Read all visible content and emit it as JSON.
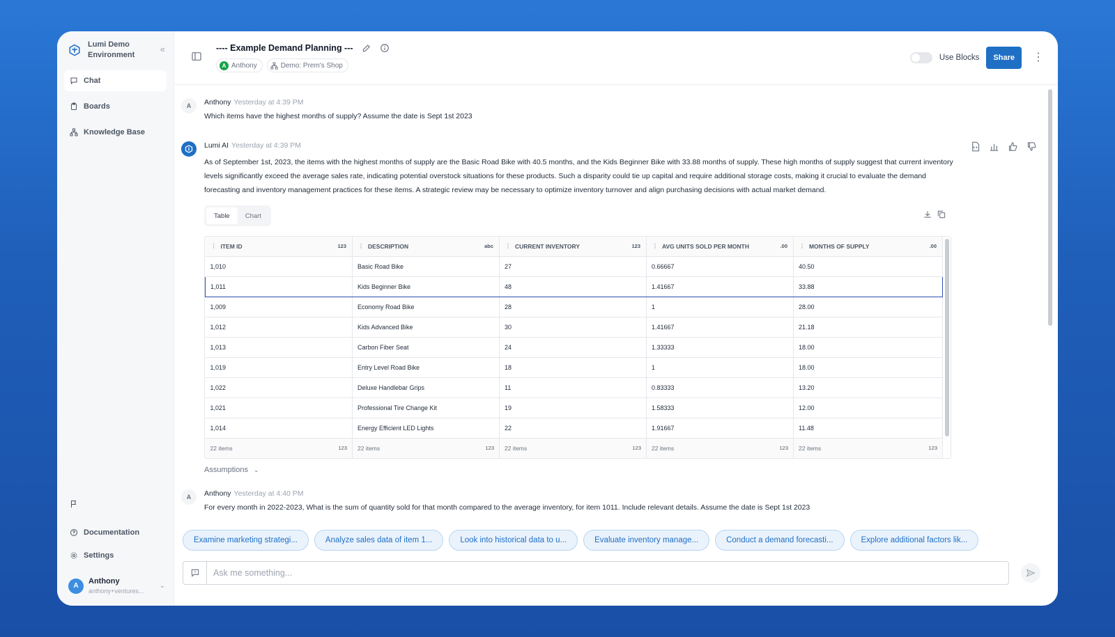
{
  "sidebar": {
    "brand": "Lumi Demo Environment",
    "nav": [
      {
        "label": "Chat",
        "icon": "chat-bubble-icon",
        "active": true
      },
      {
        "label": "Boards",
        "icon": "clipboard-icon",
        "active": false
      },
      {
        "label": "Knowledge Base",
        "icon": "hierarchy-icon",
        "active": false
      }
    ],
    "documentation": "Documentation",
    "settings": "Settings",
    "user": {
      "initial": "A",
      "name": "Anthony",
      "email": "anthony+ventures..."
    }
  },
  "header": {
    "title": "---- Example Demand Planning ---",
    "owner_initial": "A",
    "owner": "Anthony",
    "workspace": "Demo: Prem's Shop",
    "use_blocks_label": "Use Blocks",
    "share_label": "Share"
  },
  "messages": [
    {
      "author": "Anthony",
      "initial": "A",
      "time": "Yesterday at 4:39 PM",
      "text": "Which items have the highest months of supply? Assume the date is Sept 1st 2023"
    },
    {
      "author": "Lumi AI",
      "time": "Yesterday at 4:39 PM",
      "text": "As of September 1st, 2023, the items with the highest months of supply are the Basic Road Bike with 40.5 months, and the Kids Beginner Bike with 33.88 months of supply. These high months of supply suggest that current inventory levels significantly exceed the average sales rate, indicating potential overstock situations for these products. Such a disparity could tie up capital and require additional storage costs, making it crucial to evaluate the demand forecasting and inventory management practices for these items. A strategic review may be necessary to optimize inventory turnover and align purchasing decisions with actual market demand."
    },
    {
      "author": "Anthony",
      "initial": "A",
      "time": "Yesterday at 4:40 PM",
      "text": "For every month in 2022-2023, What is the sum of quantity sold for that month compared to the average inventory, for item 1011. Include relevant details. Assume the date is Sept 1st 2023"
    }
  ],
  "result": {
    "tabs": [
      "Table",
      "Chart"
    ],
    "active_tab": "Table",
    "columns": [
      {
        "label": "ITEM ID",
        "type": "123"
      },
      {
        "label": "DESCRIPTION",
        "type": "abc"
      },
      {
        "label": "CURRENT INVENTORY",
        "type": "123"
      },
      {
        "label": "AVG UNITS SOLD PER MONTH",
        "type": ".00"
      },
      {
        "label": "MONTHS OF SUPPLY",
        "type": ".00"
      }
    ],
    "rows": [
      [
        "1,010",
        "Basic Road Bike",
        "27",
        "0.66667",
        "40.50"
      ],
      [
        "1,011",
        "Kids Beginner Bike",
        "48",
        "1.41667",
        "33.88"
      ],
      [
        "1,009",
        "Economy Road Bike",
        "28",
        "1",
        "28.00"
      ],
      [
        "1,012",
        "Kids Advanced Bike",
        "30",
        "1.41667",
        "21.18"
      ],
      [
        "1,013",
        "Carbon Fiber Seat",
        "24",
        "1.33333",
        "18.00"
      ],
      [
        "1,019",
        "Entry Level Road Bike",
        "18",
        "1",
        "18.00"
      ],
      [
        "1,022",
        "Deluxe Handlebar Grips",
        "11",
        "0.83333",
        "13.20"
      ],
      [
        "1,021",
        "Professional Tire Change Kit",
        "19",
        "1.58333",
        "12.00"
      ],
      [
        "1,014",
        "Energy Efficient LED Lights",
        "22",
        "1.91667",
        "11.48"
      ]
    ],
    "selected_row": 1,
    "footer_count": "22 items",
    "footer_type": "123",
    "assumptions_label": "Assumptions"
  },
  "suggestions": [
    "Examine marketing strategi...",
    "Analyze sales data of item 1...",
    "Look into historical data to u...",
    "Evaluate inventory manage...",
    "Conduct a demand forecasti...",
    "Explore additional factors lik..."
  ],
  "composer": {
    "placeholder": "Ask me something..."
  },
  "colors": {
    "accent": "#1f6fc5",
    "selection": "#2a4db0",
    "background": "#1f5fba"
  }
}
